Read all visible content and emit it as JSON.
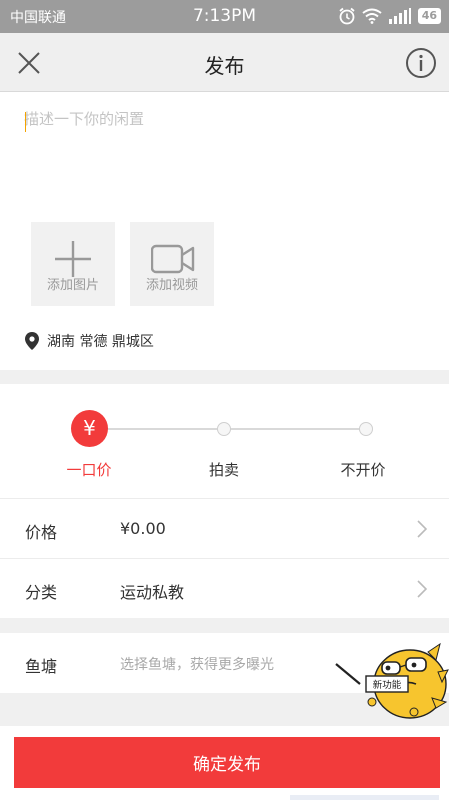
{
  "status_bar": {
    "carrier": "中国联通",
    "time": "7:13PM",
    "battery": "46",
    "icons": [
      "alarm-icon",
      "wifi-icon",
      "signal-icon",
      "battery-icon"
    ]
  },
  "header": {
    "title": "发布",
    "close_icon": "close-icon",
    "info_icon": "info-icon"
  },
  "compose": {
    "placeholder": "描述一下你的闲置",
    "value": "",
    "media": [
      {
        "label": "添加图片",
        "icon": "plus-icon"
      },
      {
        "label": "添加视频",
        "icon": "video-camera-icon"
      }
    ],
    "location": "湖南 常德 鼎城区"
  },
  "price_mode": {
    "options": [
      "一口价",
      "拍卖",
      "不开价"
    ],
    "selected_index": 0,
    "active_symbol": "¥"
  },
  "rows": [
    {
      "label": "价格",
      "value": "¥0.00"
    },
    {
      "label": "分类",
      "value": "运动私教"
    }
  ],
  "fishpond": {
    "label": "鱼塘",
    "hint": "选择鱼塘，获得更多曝光",
    "badge": "新功能"
  },
  "submit": {
    "label": "确定发布"
  },
  "colors": {
    "accent": "#f23b3b",
    "mascot": "#f7c52e",
    "status_bar": "#9c9c9c"
  }
}
